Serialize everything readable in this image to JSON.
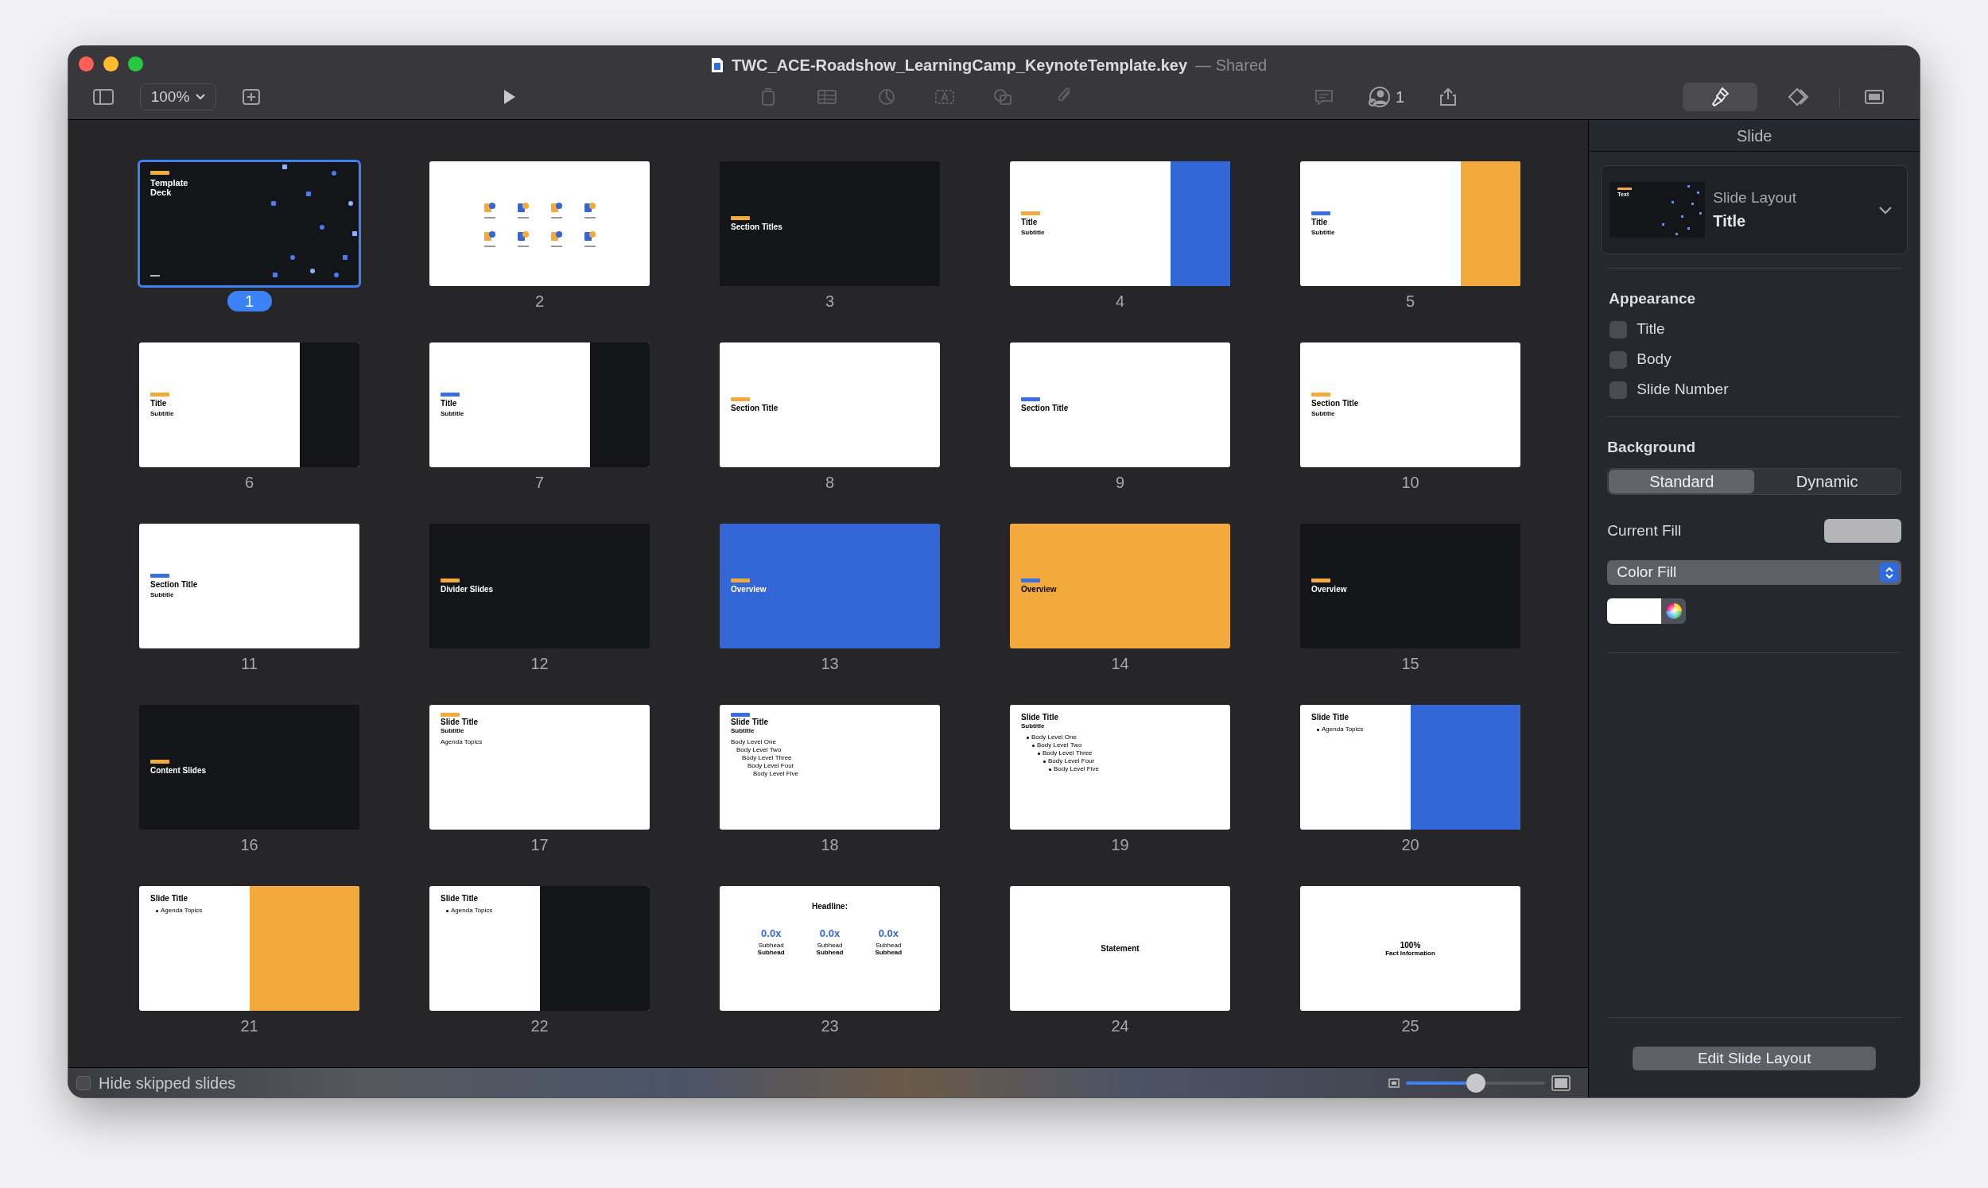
{
  "window": {
    "title": "TWC_ACE-Roadshow_LearningCamp_KeynoteTemplate.key",
    "shared_label": "— Shared"
  },
  "toolbar": {
    "zoom": "100%",
    "collaborators": "1",
    "format_selected": true
  },
  "slides": [
    {
      "number": "1",
      "selected": true,
      "kind": "cover",
      "color": "#141518",
      "tag": {
        "color": "#f2aa3c"
      },
      "title": "Template Deck"
    },
    {
      "number": "2",
      "selected": false,
      "kind": "icons",
      "color": "#ffffff"
    },
    {
      "number": "3",
      "selected": false,
      "kind": "section",
      "color": "#141518",
      "tag": {
        "color": "#f2aa3c"
      },
      "title": "Section Titles"
    },
    {
      "number": "4",
      "selected": false,
      "kind": "split",
      "color": "#ffffff",
      "panel": {
        "color": "#3366d6"
      },
      "tag": {
        "color": "#f2aa3c"
      },
      "title": "Title",
      "subtitle": "Subtitle"
    },
    {
      "number": "5",
      "selected": false,
      "kind": "split",
      "color": "#ffffff",
      "panel": {
        "color": "#f2aa3c"
      },
      "tag": {
        "color": "#3b6fe0"
      },
      "title": "Title",
      "subtitle": "Subtitle"
    },
    {
      "number": "6",
      "selected": false,
      "kind": "split",
      "color": "#ffffff",
      "panel": {
        "color": "#141518"
      },
      "tag": {
        "color": "#f2aa3c"
      },
      "title": "Title",
      "subtitle": "Subtitle"
    },
    {
      "number": "7",
      "selected": false,
      "kind": "split",
      "color": "#ffffff",
      "panel": {
        "color": "#141518"
      },
      "tag": {
        "color": "#3b6fe0"
      },
      "title": "Title",
      "subtitle": "Subtitle"
    },
    {
      "number": "8",
      "selected": false,
      "kind": "section",
      "color": "#ffffff",
      "tag": {
        "color": "#f2aa3c"
      },
      "title": "Section Title"
    },
    {
      "number": "9",
      "selected": false,
      "kind": "section",
      "color": "#ffffff",
      "tag": {
        "color": "#3b6fe0"
      },
      "title": "Section Title"
    },
    {
      "number": "10",
      "selected": false,
      "kind": "section",
      "color": "#ffffff",
      "tag": {
        "color": "#f2aa3c"
      },
      "title": "Section Title",
      "subtitle": "Subtitle"
    },
    {
      "number": "11",
      "selected": false,
      "kind": "section",
      "color": "#ffffff",
      "tag": {
        "color": "#3b6fe0"
      },
      "title": "Section Title",
      "subtitle": "Subtitle"
    },
    {
      "number": "12",
      "selected": false,
      "kind": "section",
      "color": "#141518",
      "tag": {
        "color": "#f2aa3c"
      },
      "title": "Divider Slides"
    },
    {
      "number": "13",
      "selected": false,
      "kind": "section",
      "color": "#3366d6",
      "tag": {
        "color": "#f2aa3c"
      },
      "title": "Overview"
    },
    {
      "number": "14",
      "selected": false,
      "kind": "section",
      "color": "#f2aa3c",
      "tag": {
        "color": "#3b6fe0"
      },
      "title": "Overview"
    },
    {
      "number": "15",
      "selected": false,
      "kind": "section",
      "color": "#141518",
      "tag": {
        "color": "#f2aa3c"
      },
      "title": "Overview"
    },
    {
      "number": "16",
      "selected": false,
      "kind": "section",
      "color": "#141518",
      "tag": {
        "color": "#f2aa3c"
      },
      "title": "Content Slides"
    },
    {
      "number": "17",
      "selected": false,
      "kind": "content",
      "color": "#ffffff",
      "tag": {
        "color": "#f2aa3c"
      },
      "title": "Slide Title",
      "subtitle": "Subtitle",
      "bulleted": false,
      "items": [
        {
          "text": "Agenda Topics"
        }
      ]
    },
    {
      "number": "18",
      "selected": false,
      "kind": "content",
      "color": "#ffffff",
      "tag": {
        "color": "#3b6fe0"
      },
      "title": "Slide Title",
      "subtitle": "Subtitle",
      "bulleted": false,
      "items": [
        {
          "text": "Body Level One",
          "children": [
            {
              "text": "Body Level Two",
              "children": [
                {
                  "text": "Body Level Three",
                  "children": [
                    {
                      "text": "Body Level Four",
                      "children": [
                        {
                          "text": "Body Level Five"
                        }
                      ]
                    }
                  ]
                }
              ]
            }
          ]
        }
      ]
    },
    {
      "number": "19",
      "selected": false,
      "kind": "content",
      "color": "#ffffff",
      "title": "Slide Title",
      "subtitle": "Subtitle",
      "bulleted": true,
      "items": [
        {
          "text": "Body Level One",
          "children": [
            {
              "text": "Body Level Two",
              "children": [
                {
                  "text": "Body Level Three",
                  "children": [
                    {
                      "text": "Body Level Four",
                      "children": [
                        {
                          "text": "Body Level Five"
                        }
                      ]
                    }
                  ]
                }
              ]
            }
          ]
        }
      ]
    },
    {
      "number": "20",
      "selected": false,
      "kind": "half",
      "color": "#ffffff",
      "panel": {
        "color": "#3366d6"
      },
      "title": "Slide Title",
      "bulleted": true,
      "items": [
        {
          "text": "Agenda Topics"
        }
      ]
    },
    {
      "number": "21",
      "selected": false,
      "kind": "half",
      "color": "#ffffff",
      "panel": {
        "color": "#f2aa3c"
      },
      "title": "Slide Title",
      "bulleted": true,
      "items": [
        {
          "text": "Agenda Topics"
        }
      ]
    },
    {
      "number": "22",
      "selected": false,
      "kind": "half",
      "color": "#ffffff",
      "panel": {
        "color": "#141518"
      },
      "title": "Slide Title",
      "bulleted": true,
      "items": [
        {
          "text": "Agenda Topics"
        }
      ]
    },
    {
      "number": "23",
      "selected": false,
      "kind": "stats",
      "color": "#ffffff",
      "title": "Headline:",
      "stats": [
        {
          "value": "0.0x",
          "line_1": "Subhead",
          "line_2": "Subhead"
        },
        {
          "value": "0.0x",
          "line_1": "Subhead",
          "line_2": "Subhead"
        },
        {
          "value": "0.0x",
          "line_1": "Subhead",
          "line_2": "Subhead"
        }
      ]
    },
    {
      "number": "24",
      "selected": false,
      "kind": "statement",
      "color": "#ffffff",
      "title": "Statement"
    },
    {
      "number": "25",
      "selected": false,
      "kind": "statement",
      "color": "#ffffff",
      "title": "100%",
      "subtitle": "Fact Information"
    }
  ],
  "inspector": {
    "tab": "Slide",
    "layout_label": "Slide Layout",
    "layout_name": "Title",
    "layout_thumb_title": "Text",
    "appearance_heading": "Appearance",
    "appearance": [
      {
        "label": "Title",
        "checked": false
      },
      {
        "label": "Body",
        "checked": false
      },
      {
        "label": "Slide Number",
        "checked": false
      }
    ],
    "background_heading": "Background",
    "background_modes": [
      {
        "label": "Standard",
        "selected": true
      },
      {
        "label": "Dynamic",
        "selected": false
      }
    ],
    "current_fill_label": "Current Fill",
    "fill_type": "Color Fill",
    "edit_button": "Edit Slide Layout"
  },
  "bottom_bar": {
    "hide_skipped": {
      "label": "Hide skipped slides",
      "checked": false
    },
    "thumbnail_size": {
      "level": 0.5
    }
  }
}
